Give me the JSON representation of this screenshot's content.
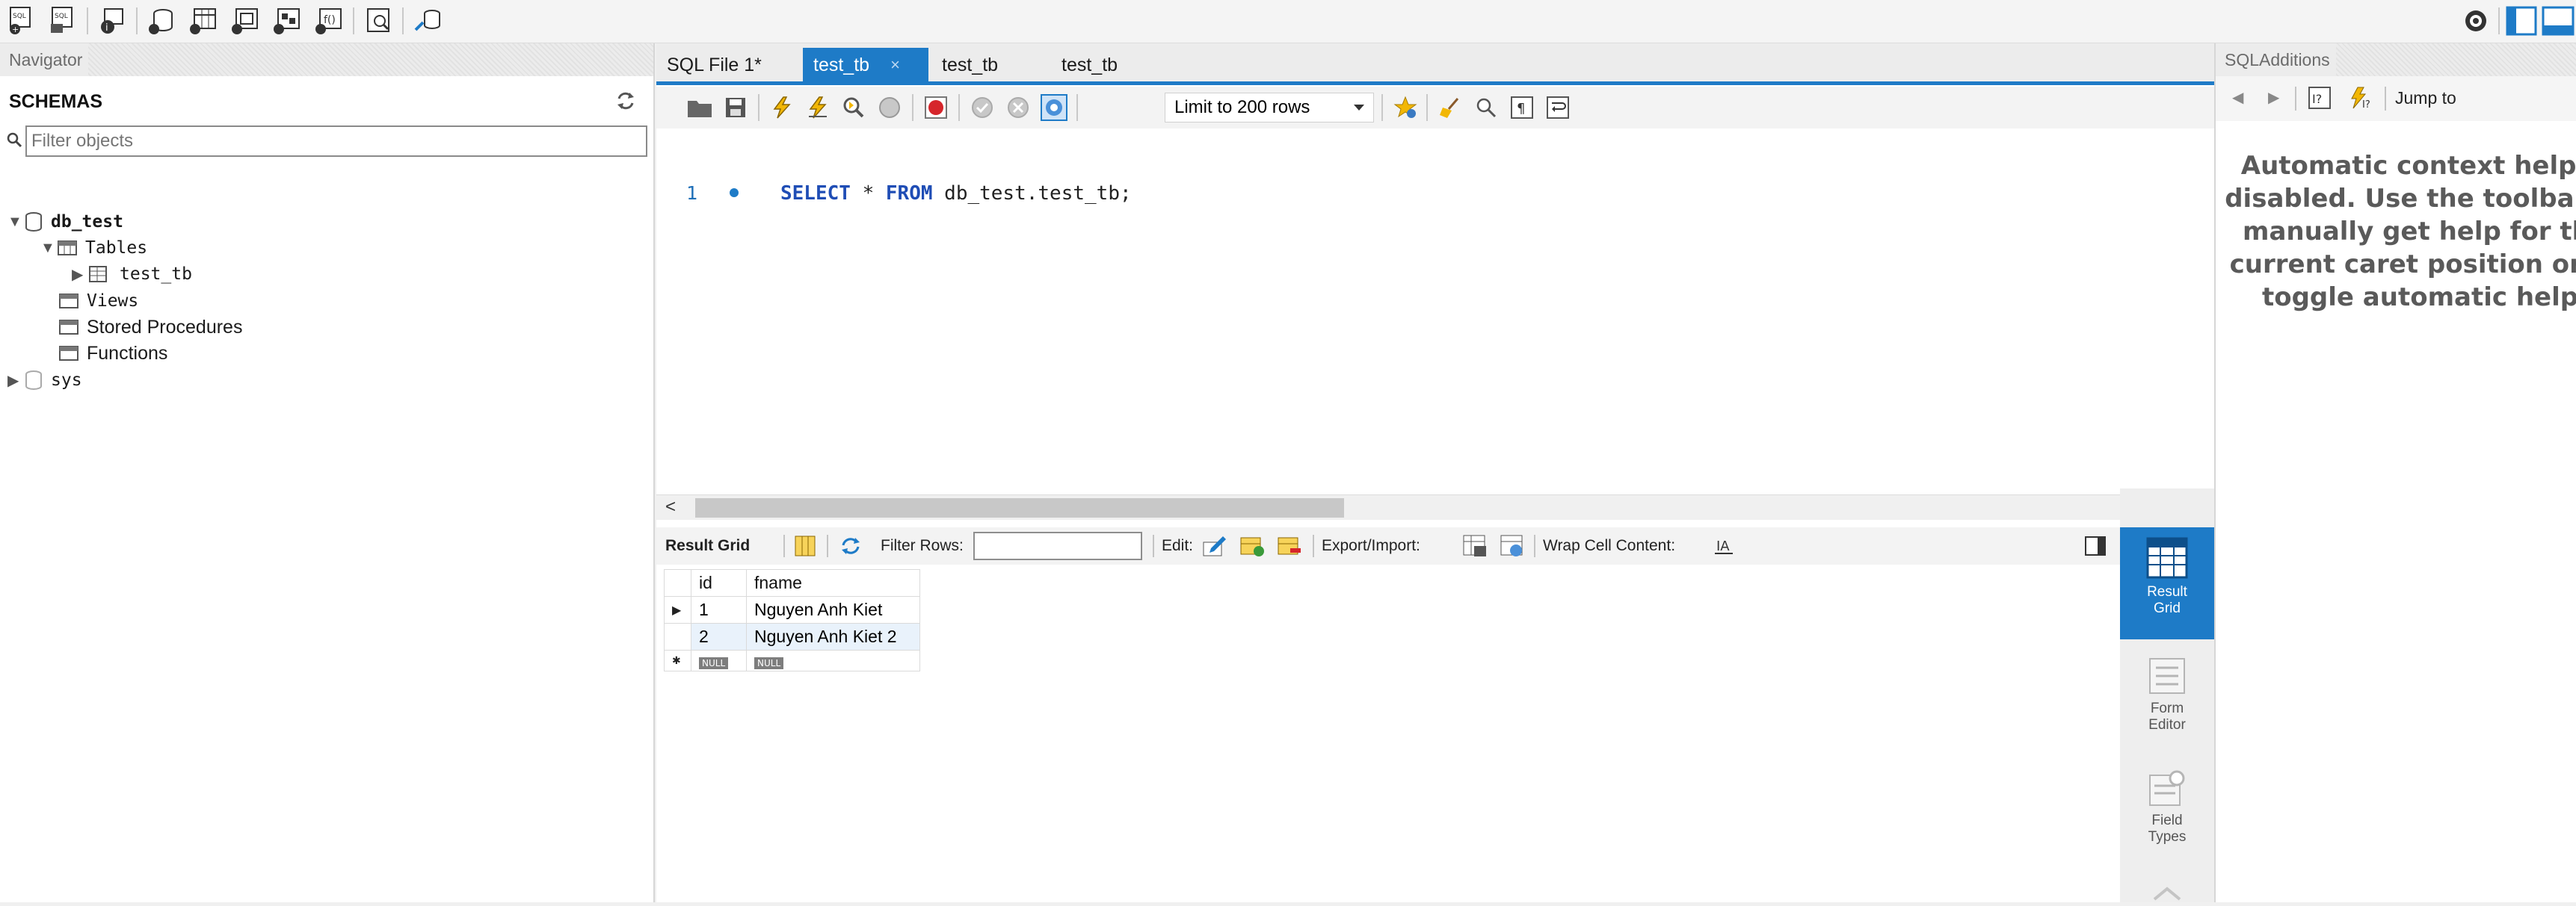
{
  "navigator": {
    "header": "Navigator",
    "schemas_label": "SCHEMAS",
    "filter_placeholder": "Filter objects",
    "tree": {
      "db": "db_test",
      "tables": "Tables",
      "table_item": "test_tb",
      "views": "Views",
      "procedures": "Stored Procedures",
      "functions": "Functions",
      "sys": "sys"
    }
  },
  "tabs": [
    {
      "label": "SQL File 1*"
    },
    {
      "label": "test_tb"
    },
    {
      "label": "test_tb"
    },
    {
      "label": "test_tb"
    }
  ],
  "editor_toolbar": {
    "limit_label": "Limit to 200 rows"
  },
  "editor": {
    "line_number": "1",
    "code_kw1": "SELECT",
    "code_mid": " * ",
    "code_kw2": "FROM",
    "code_rest": " db_test.test_tb;"
  },
  "result_toolbar": {
    "result_grid": "Result Grid",
    "filter_rows": "Filter Rows:",
    "edit": "Edit:",
    "export_import": "Export/Import:",
    "wrap": "Wrap Cell Content:"
  },
  "grid": {
    "columns": [
      "id",
      "fname"
    ],
    "rows": [
      [
        "1",
        "Nguyen Anh Kiet"
      ],
      [
        "2",
        "Nguyen Anh Kiet 2"
      ]
    ],
    "null_label": "NULL"
  },
  "side_tabs": {
    "result_grid": [
      "Result",
      "Grid"
    ],
    "form_editor": [
      "Form",
      "Editor"
    ],
    "field_types": [
      "Field",
      "Types"
    ]
  },
  "sql_additions": {
    "header": "SQLAdditions",
    "jump_to": "Jump to",
    "help_lines": [
      "Automatic context help is",
      "disabled. Use the toolbar to",
      "manually get help for the",
      "current caret position or to",
      "toggle automatic help."
    ]
  },
  "colors": {
    "accent": "#1e7bc7",
    "keyword": "#1f4db5"
  }
}
